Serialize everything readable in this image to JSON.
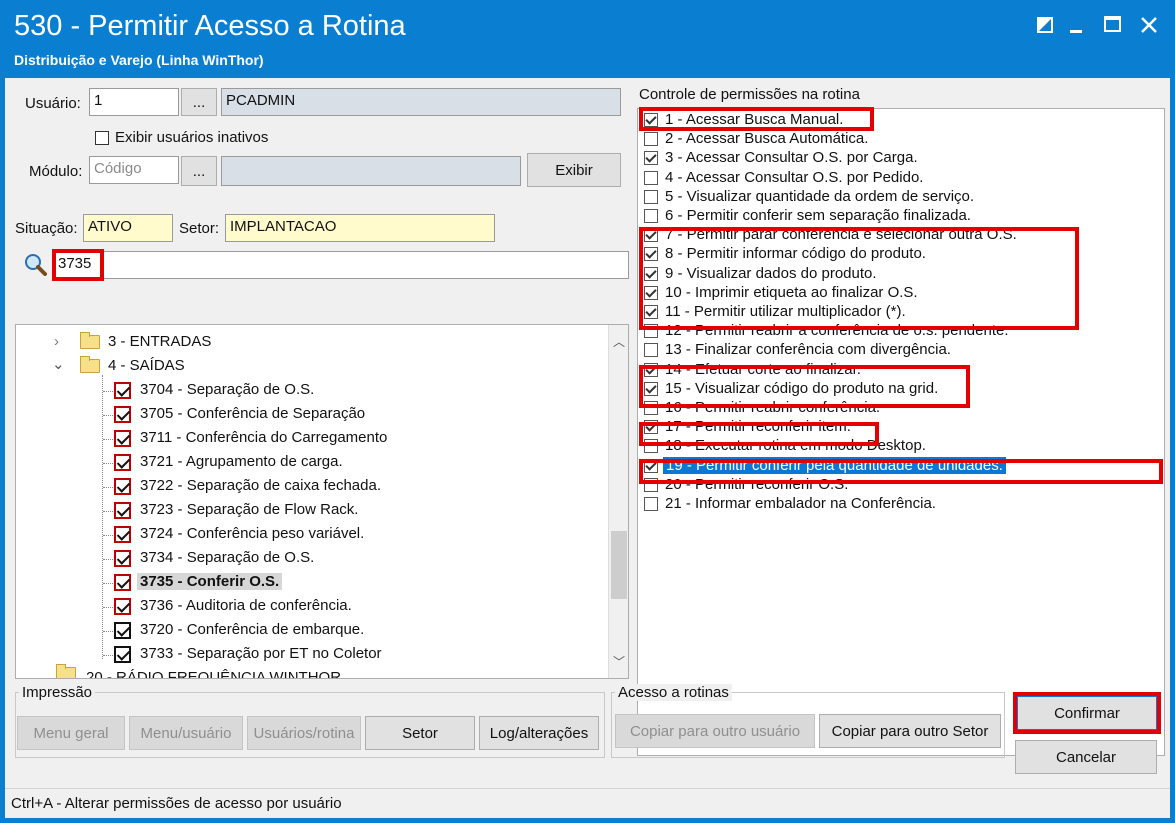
{
  "window": {
    "title": "530 - Permitir Acesso a Rotina",
    "subtitle": "Distribuição e Varejo (Linha WinThor)",
    "controls": [
      "restore-icon",
      "minimize-icon",
      "maximize-icon",
      "close-icon"
    ]
  },
  "user": {
    "label": "Usuário:",
    "code": "1",
    "browse": "...",
    "name": "PCADMIN",
    "inactive_label": "Exibir usuários inativos"
  },
  "module": {
    "label": "Módulo:",
    "placeholder": "Código",
    "browse": "...",
    "show_button": "Exibir"
  },
  "status": {
    "situacao_label": "Situação:",
    "situacao_value": "ATIVO",
    "setor_label": "Setor:",
    "setor_value": "IMPLANTACAO"
  },
  "search": {
    "value": "3735",
    "icon": "search-icon"
  },
  "tree": {
    "folders": [
      {
        "label": "3 - ENTRADAS",
        "expanded": false
      },
      {
        "label": "4 - SAÍDAS",
        "expanded": true
      }
    ],
    "items": [
      "3704 - Separação de O.S.",
      "3705 - Conferência de Separação",
      "3711 - Conferência do Carregamento",
      "3721 - Agrupamento de carga.",
      "3722 - Separação de caixa fechada.",
      "3723 - Separação de Flow Rack.",
      "3724 - Conferência peso variável.",
      "3734 - Separação de O.S.",
      "3735 - Conferir O.S.",
      "3736 - Auditoria de conferência.",
      "3720 - Conferência de embarque.",
      "3733 - Separação por ET no Coletor"
    ],
    "cut_off_label": "20 - RÁDIO FREQUÊNCIA WINTHOR"
  },
  "permissions": {
    "title": "Controle de permissões na rotina",
    "items": [
      {
        "label": "1 - Acessar Busca Manual.",
        "checked": true
      },
      {
        "label": "2 - Acessar Busca Automática.",
        "checked": false
      },
      {
        "label": "3 - Acessar Consultar O.S. por Carga.",
        "checked": true
      },
      {
        "label": "4 - Acessar Consultar O.S. por Pedido.",
        "checked": false
      },
      {
        "label": "5 - Visualizar quantidade da ordem de serviço.",
        "checked": false
      },
      {
        "label": "6 - Permitir conferir sem separação finalizada.",
        "checked": false
      },
      {
        "label": "7 - Permitir parar conferência e selecionar outra O.S.",
        "checked": true
      },
      {
        "label": "8 - Permitir informar código do produto.",
        "checked": true
      },
      {
        "label": "9 - Visualizar dados do produto.",
        "checked": true
      },
      {
        "label": "10 - Imprimir etiqueta ao finalizar O.S.",
        "checked": true
      },
      {
        "label": "11 - Permitir utilizar multiplicador (*).",
        "checked": true
      },
      {
        "label": "12 - Permitir reabrir a conferência de o.s. pendente.",
        "checked": false
      },
      {
        "label": "13 - Finalizar conferência com divergência.",
        "checked": false
      },
      {
        "label": "14 - Efetuar corte ao finalizar.",
        "checked": true
      },
      {
        "label": "15 - Visualizar código do produto na grid.",
        "checked": true
      },
      {
        "label": "16 - Permitir reabrir conferência.",
        "checked": false
      },
      {
        "label": "17 - Permitir reconferir item.",
        "checked": true
      },
      {
        "label": "18 - Executar rotina em modo Desktop.",
        "checked": false
      },
      {
        "label": "19 - Permitir conferir pela quantidade de unidades.",
        "checked": true,
        "selected": true
      },
      {
        "label": "20 - Permitir reconferir O.S.",
        "checked": false
      },
      {
        "label": "21 - Informar embalador na Conferência.",
        "checked": false
      }
    ]
  },
  "impressao": {
    "title": "Impressão",
    "buttons": [
      "Menu geral",
      "Menu/usuário",
      "Usuários/rotina",
      "Setor",
      "Log/alterações"
    ]
  },
  "acesso": {
    "title": "Acesso a rotinas",
    "buttons": [
      "Copiar para outro usuário",
      "Copiar para outro Setor"
    ]
  },
  "actions": {
    "confirm": "Confirmar",
    "cancel": "Cancelar"
  },
  "statusbar": "Ctrl+A - Alterar permissões de acesso por usuário",
  "colors": {
    "titlebar": "#0a7fd1",
    "highlight": "#e40000",
    "selection": "#0a78d4"
  }
}
